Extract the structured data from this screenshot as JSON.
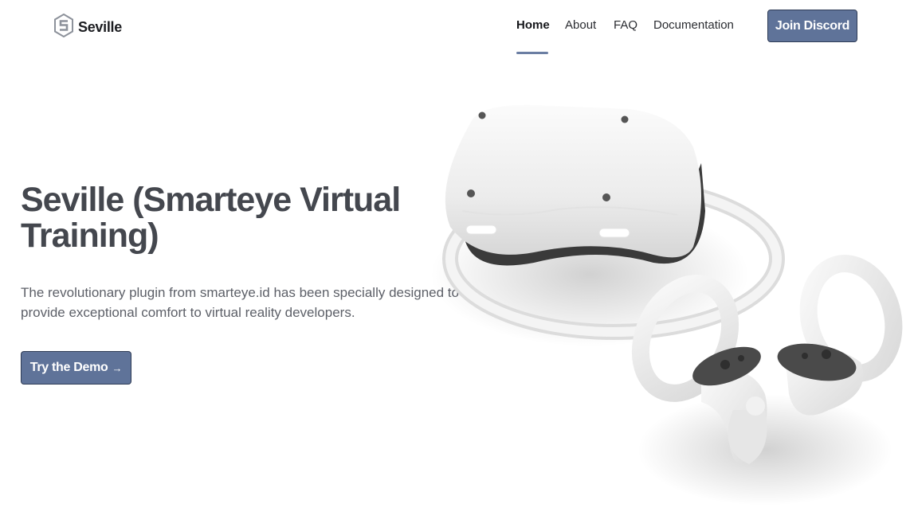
{
  "brand": {
    "name": "Seville",
    "logo_icon": "hexagon-s-logo-icon"
  },
  "nav": {
    "items": [
      {
        "label": "Home",
        "active": true
      },
      {
        "label": "About",
        "active": false
      },
      {
        "label": "FAQ",
        "active": false
      },
      {
        "label": "Documentation",
        "active": false
      }
    ],
    "cta_label": "Join Discord"
  },
  "hero": {
    "title": "Seville (Smarteye Virtual Training)",
    "description": "The revolutionary plugin from smarteye.id has been specially designed to provide exceptional comfort to virtual reality developers.",
    "cta_label": "Try the Demo",
    "cta_icon": "arrow-right-icon",
    "image": "vr-headset-with-controllers"
  },
  "colors": {
    "accent": "#5f7399",
    "accent_border": "#2f3c56",
    "underline": "#6b7ea3",
    "heading": "#44474e"
  }
}
